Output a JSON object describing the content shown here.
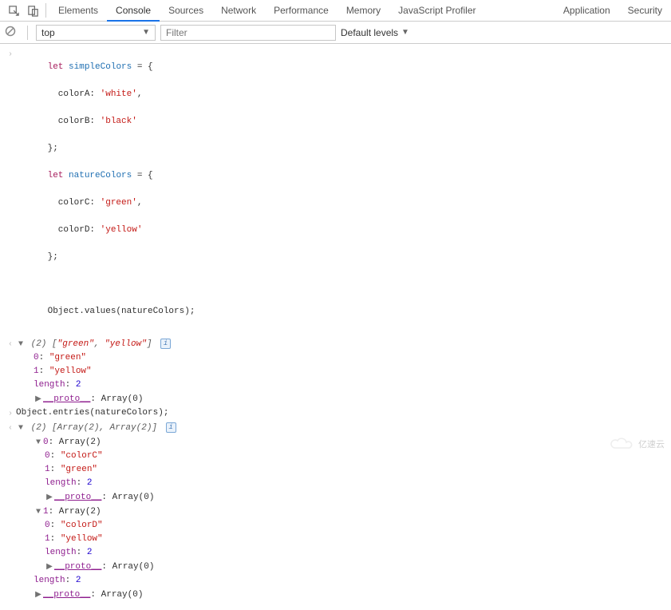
{
  "tabs": {
    "elements": "Elements",
    "console": "Console",
    "sources": "Sources",
    "network": "Network",
    "performance": "Performance",
    "memory": "Memory",
    "js_profiler": "JavaScript Profiler",
    "application": "Application",
    "security": "Security"
  },
  "toolbar": {
    "context": "top",
    "filter_placeholder": "Filter",
    "levels": "Default levels"
  },
  "snippet1": {
    "l1": "let simpleColors = {",
    "l2_key": "  colorA: ",
    "l2_val": "'white'",
    "l2_comma": ",",
    "l3_key": "  colorB: ",
    "l3_val": "'black'",
    "l4": "};",
    "l5": "let natureColors = {",
    "l6_key": "  colorC: ",
    "l6_val": "'green'",
    "l6_comma": ",",
    "l7_key": "  colorD: ",
    "l7_val": "'yellow'",
    "l8": "};",
    "blank": " ",
    "call": "Object.values(natureColors);"
  },
  "result1": {
    "summary": "(2) [\"green\", \"yellow\"]",
    "k0": "0",
    "v0": "\"green\"",
    "k1": "1",
    "v1": "\"yellow\"",
    "len_key": "length",
    "len_val": "2",
    "proto_key": "__proto__",
    "proto_val": ": Array(0)"
  },
  "snippet2": {
    "call": "Object.entries(natureColors);"
  },
  "result2": {
    "summary": "(2) [Array(2), Array(2)]",
    "e0_head_key": "0",
    "e0_head_val": ": Array(2)",
    "e0_k0": "0",
    "e0_v0": "\"colorC\"",
    "e0_k1": "1",
    "e0_v1": "\"green\"",
    "e0_len_key": "length",
    "e0_len_val": "2",
    "e0_proto_key": "__proto__",
    "e0_proto_val": ": Array(0)",
    "e1_head_key": "1",
    "e1_head_val": ": Array(2)",
    "e1_k0": "0",
    "e1_v0": "\"colorD\"",
    "e1_k1": "1",
    "e1_v1": "\"yellow\"",
    "e1_len_key": "length",
    "e1_len_val": "2",
    "e1_proto_key": "__proto__",
    "e1_proto_val": ": Array(0)",
    "outer_len_key": "length",
    "outer_len_val": "2",
    "outer_proto_key": "__proto__",
    "outer_proto_val": ": Array(0)"
  },
  "info_char": "i",
  "watermark": "亿速云"
}
